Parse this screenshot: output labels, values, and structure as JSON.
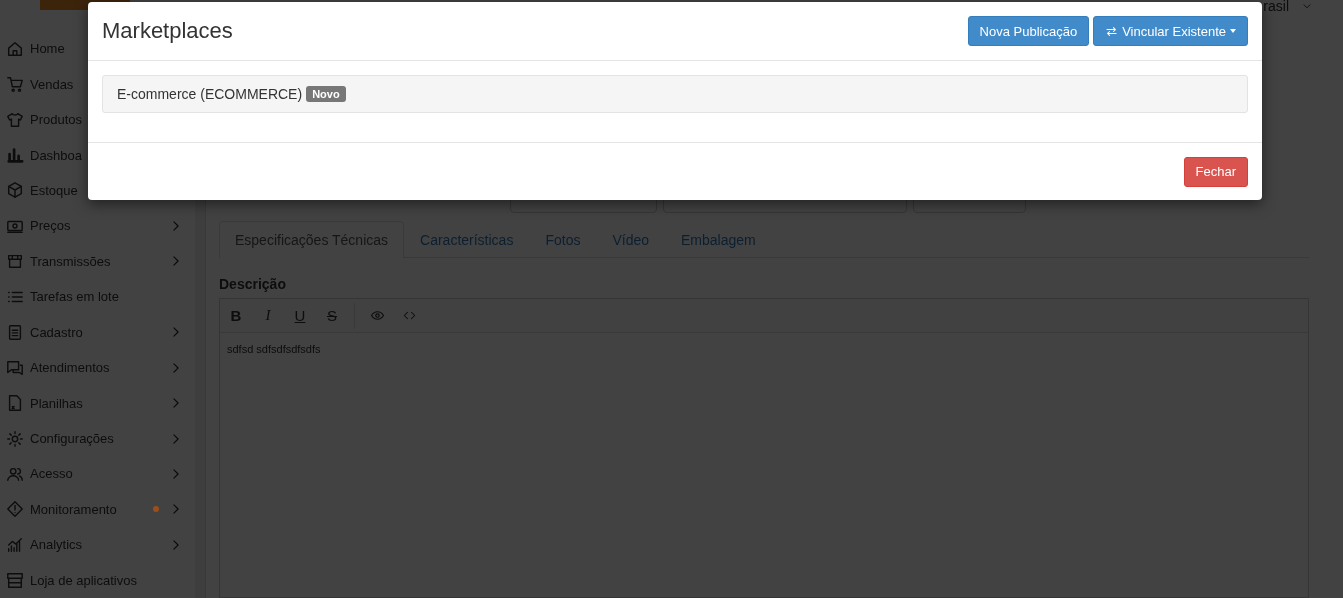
{
  "header": {
    "region": "rasil"
  },
  "sidebar": {
    "items": [
      {
        "label": "Home",
        "expandable": false
      },
      {
        "label": "Vendas",
        "expandable": false
      },
      {
        "label": "Produtos",
        "expandable": false
      },
      {
        "label": "Dashboa",
        "expandable": false
      },
      {
        "label": "Estoque",
        "expandable": false
      },
      {
        "label": "Preços",
        "expandable": true
      },
      {
        "label": "Transmissões",
        "expandable": true
      },
      {
        "label": "Tarefas em lote",
        "expandable": false
      },
      {
        "label": "Cadastro",
        "expandable": true
      },
      {
        "label": "Atendimentos",
        "expandable": true
      },
      {
        "label": "Planilhas",
        "expandable": true
      },
      {
        "label": "Configurações",
        "expandable": true
      },
      {
        "label": "Acesso",
        "expandable": true
      },
      {
        "label": "Monitoramento",
        "expandable": true,
        "color": "#9a4f1c"
      },
      {
        "label": "Analytics",
        "expandable": true
      },
      {
        "label": "Loja de aplicativos",
        "expandable": false
      }
    ]
  },
  "tabs": [
    {
      "label": "Especificações Técnicas",
      "selected": true
    },
    {
      "label": "Características",
      "selected": false
    },
    {
      "label": "Fotos",
      "selected": false
    },
    {
      "label": "Vídeo",
      "selected": false
    },
    {
      "label": "Embalagem",
      "selected": false
    }
  ],
  "description": {
    "label": "Descrição",
    "toolbar": [
      "B",
      "I",
      "U",
      "S"
    ],
    "content": "sdfsd sdfsdfsdfsdfs"
  },
  "modal": {
    "title": "Marketplaces",
    "buttons": [
      {
        "label": "Nova Publicação",
        "kind": "plain"
      },
      {
        "label": "Vincular Existente",
        "kind": "dropdown"
      }
    ],
    "items": [
      {
        "label": "E-commerce (ECOMMERCE)",
        "badge": "Novo"
      }
    ],
    "close_button": "Fechar"
  }
}
